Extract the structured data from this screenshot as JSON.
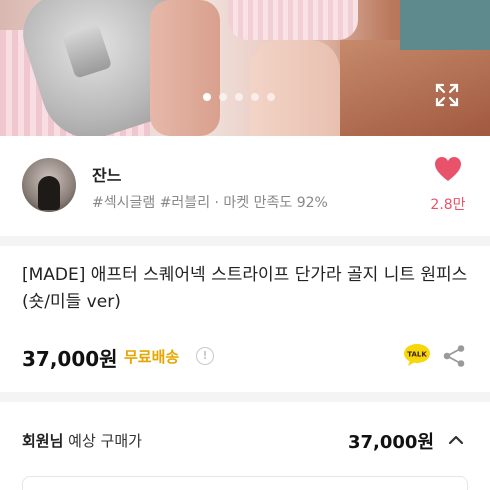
{
  "gallery": {
    "page_count": 5,
    "active_index": 0
  },
  "seller": {
    "name": "잔느",
    "tags": "#섹시글램 #러블리 · 마켓 만족도 92%",
    "likes": "2.8만"
  },
  "product": {
    "title": "[MADE] 애프터 스퀘어넥 스트라이프 단가라 골지 니트 원피스(숏/미들 ver)",
    "price": "37,000원",
    "shipping": "무료배송"
  },
  "member": {
    "label_bold": "회원님",
    "label_rest": " 예상 구매가",
    "price": "37,000원"
  },
  "colors": {
    "accent": "#e8536b",
    "shipping": "#e7a500"
  },
  "icons": [
    "expand-icon",
    "heart-icon",
    "info-icon",
    "talk-icon",
    "share-icon",
    "chevron-up-icon"
  ]
}
